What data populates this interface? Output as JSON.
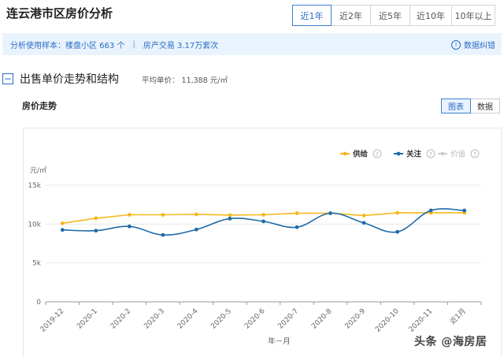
{
  "page_title": "连云港市区房价分析",
  "range_tabs": [
    {
      "label": "近1年",
      "active": true
    },
    {
      "label": "近2年",
      "active": false
    },
    {
      "label": "近5年",
      "active": false
    },
    {
      "label": "近10年",
      "active": false
    },
    {
      "label": "10年以上",
      "active": false
    }
  ],
  "info_bar": {
    "sample_text": "分析使用样本：楼盘小区 663 个",
    "separator": "|",
    "trade_text": "房产交易 3.17万套次",
    "feedback_label": "数据纠错",
    "info_glyph": "i"
  },
  "section": {
    "collapse_glyph": "−",
    "title": "出售单价走势和结构",
    "avg_price": "平均单价： 11,388 元/㎡"
  },
  "chart_title": "房价走势",
  "view_toggle": {
    "chart_label": "图表",
    "data_label": "数据"
  },
  "chart_data": {
    "type": "line",
    "ylabel": "元/㎡",
    "xlabel": "年－月",
    "categories": [
      "2019-12",
      "2020-1",
      "2020-2",
      "2020-3",
      "2020-4",
      "2020-5",
      "2020-6",
      "2020-7",
      "2020-8",
      "2020-9",
      "2020-10",
      "2020-11",
      "近1月"
    ],
    "yticks": [
      0,
      5000,
      10000,
      15000
    ],
    "ytick_labels": [
      "0",
      "5k",
      "10k",
      "15k"
    ],
    "ylim": [
      0,
      15000
    ],
    "grid": true,
    "legend_position": "top-right",
    "series": [
      {
        "name": "供给",
        "color": "#f5b821",
        "smooth": false,
        "visible": true,
        "values": [
          10100,
          10750,
          11200,
          11200,
          11250,
          11150,
          11200,
          11400,
          11400,
          11100,
          11450,
          11450,
          11450
        ]
      },
      {
        "name": "关注",
        "color": "#1f6aa8",
        "smooth": true,
        "visible": true,
        "values": [
          9250,
          9150,
          9700,
          8600,
          9300,
          10700,
          10350,
          9600,
          11400,
          10150,
          9000,
          11750,
          11750
        ]
      },
      {
        "name": "价值",
        "color": "#cccccc",
        "smooth": false,
        "visible": false,
        "values": []
      }
    ],
    "help_glyph": "?"
  },
  "watermark": "头条 @海房居"
}
